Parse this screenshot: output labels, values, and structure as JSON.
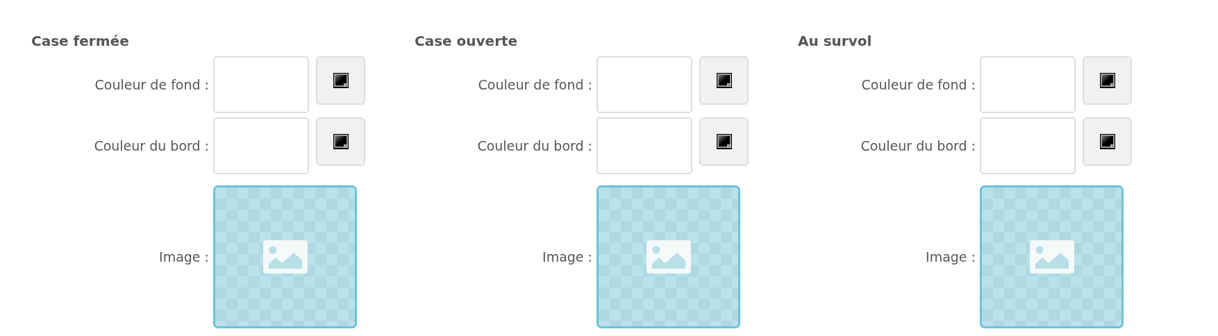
{
  "panels": [
    {
      "heading": "Case fermée",
      "rows": [
        {
          "kind": "color",
          "label": "Couleur de fond :"
        },
        {
          "kind": "color",
          "label": "Couleur du bord :"
        },
        {
          "kind": "image",
          "label": "Image :"
        }
      ]
    },
    {
      "heading": "Case ouverte",
      "rows": [
        {
          "kind": "color",
          "label": "Couleur de fond :"
        },
        {
          "kind": "color",
          "label": "Couleur du bord :"
        },
        {
          "kind": "image",
          "label": "Image :"
        }
      ]
    },
    {
      "heading": "Au survol",
      "rows": [
        {
          "kind": "color",
          "label": "Couleur de fond :"
        },
        {
          "kind": "color",
          "label": "Couleur du bord :"
        },
        {
          "kind": "image",
          "label": "Image :"
        }
      ]
    }
  ]
}
